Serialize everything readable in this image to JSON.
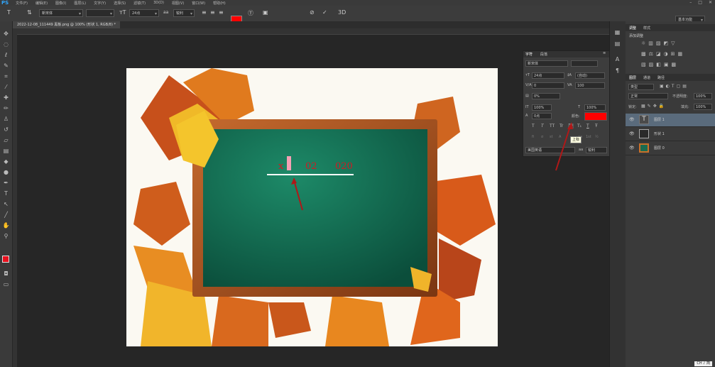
{
  "app": {
    "logo": "PS"
  },
  "menu": [
    "文件(F)",
    "编辑(E)",
    "图像(I)",
    "图层(L)",
    "文字(Y)",
    "选择(S)",
    "滤镜(T)",
    "3D(D)",
    "视图(V)",
    "窗口(W)",
    "帮助(H)"
  ],
  "window_controls": [
    "–",
    "□",
    "✕"
  ],
  "options": {
    "font_family": "新宋体",
    "font_size": "24点",
    "aa": "锐利",
    "workspace": "基本功能",
    "aa_label": "aa"
  },
  "document_tab": "2022-12-08_111449 黑板.png @ 100% (形状 1, RGB/8) *",
  "canvas_text": {
    "x": "x",
    "exp1": "02",
    "exp2": "020"
  },
  "character_panel": {
    "tabs": [
      "字符",
      "段落"
    ],
    "font": "新宋体",
    "size": "24点",
    "leading": "(自动)",
    "kerning": "0",
    "tracking": "100",
    "scale_pct": "0%",
    "vscale": "100%",
    "hscale": "100%",
    "baseline": "0点",
    "color_label": "颜色:",
    "text_color": "#ff0000",
    "language": "美国英语",
    "aa": "锐利",
    "aa_prefix": "aa",
    "style_buttons": [
      "T",
      "T",
      "TT",
      "Tr",
      "T¹",
      "T₁",
      "T",
      "Ŧ"
    ],
    "ot_buttons": [
      "fi",
      "σ",
      "st",
      "A",
      "aa",
      "T",
      "1st",
      "½"
    ],
    "tooltip": "上标"
  },
  "adjust_panel": {
    "tabs": [
      "调整",
      "样式"
    ],
    "subtitle": "添加调整"
  },
  "layers_panel": {
    "tabs": [
      "图层",
      "通道",
      "路径"
    ],
    "kind": "类型",
    "mode": "正常",
    "opacity_label": "不透明度:",
    "opacity": "100%",
    "lock_label": "锁定:",
    "fill_label": "填充:",
    "fill": "100%",
    "layers": [
      {
        "name": "图层 1",
        "type": "text",
        "selected": true
      },
      {
        "name": "形状 1",
        "type": "shape",
        "selected": false
      },
      {
        "name": "图层 0",
        "type": "image",
        "selected": false
      }
    ]
  },
  "status": {
    "ime": "CH ♪ 简"
  }
}
